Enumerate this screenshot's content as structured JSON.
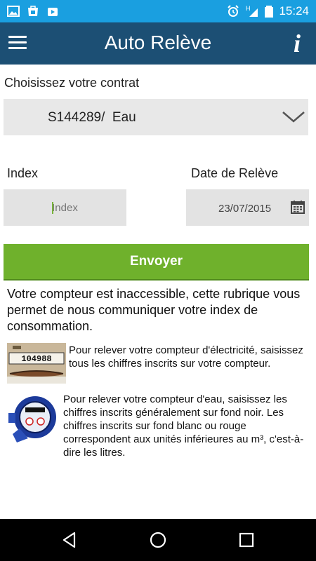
{
  "status_bar": {
    "time": "15:24",
    "left_icons": [
      "image-icon",
      "shop-icon",
      "youtube-icon"
    ],
    "right_icons": [
      "alarm-icon",
      "signal-icon",
      "battery-icon"
    ],
    "network_label": "H"
  },
  "app_bar": {
    "title": "Auto Relève",
    "info_label": "i"
  },
  "contract": {
    "label": "Choisissez votre contrat",
    "selected": "S144289/  Eau"
  },
  "index": {
    "label": "Index",
    "placeholder": "Index",
    "value": ""
  },
  "date": {
    "label": "Date de Relève",
    "value": "23/07/2015"
  },
  "send_button": "Envoyer",
  "intro": "Votre compteur est inaccessible, cette rubrique vous permet de nous communiquer votre index de consommation.",
  "help": {
    "electricity": "Pour relever votre compteur d'électricité, saisissez tous les chiffres inscrits sur votre compteur.",
    "water": "Pour relever votre compteur d'eau, saisissez les chiffres inscrits généralement sur fond noir. Les chiffres inscrits sur fond blanc ou rouge correspondent aux unités inférieures au m³, c'est-à-dire les litres.",
    "meter_digits": "104988"
  },
  "colors": {
    "status_bar": "#1a9fe0",
    "app_bar": "#1c4f74",
    "accent_green": "#6fb12c"
  }
}
